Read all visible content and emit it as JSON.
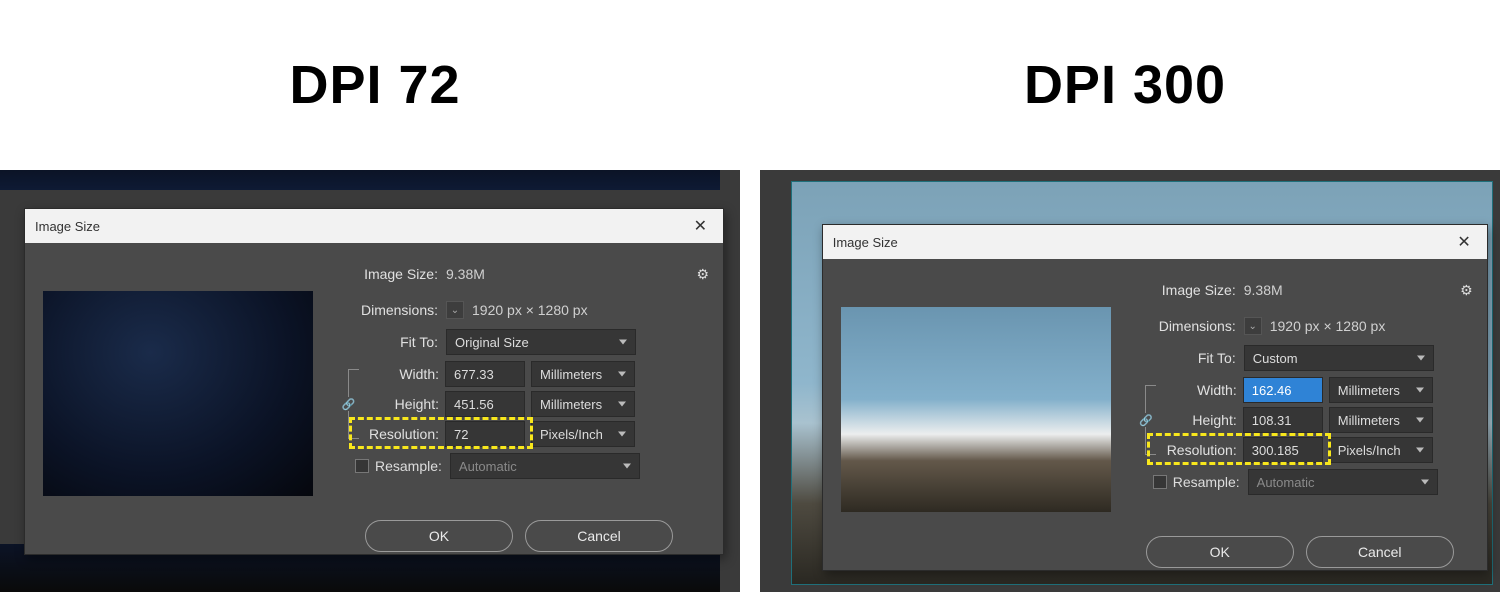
{
  "headings": {
    "left": "DPI 72",
    "right": "DPI 300"
  },
  "dialog": {
    "title": "Image Size",
    "labels": {
      "image_size": "Image Size:",
      "dimensions": "Dimensions:",
      "fit_to": "Fit To:",
      "width": "Width:",
      "height": "Height:",
      "resolution": "Resolution:",
      "resample": "Resample:"
    },
    "buttons": {
      "ok": "OK",
      "cancel": "Cancel"
    },
    "close": "✕",
    "gear": "⚙",
    "dim_toggle": "⌄",
    "link": "🔗"
  },
  "left": {
    "image_size_value": "9.38M",
    "dimensions_value": "1920 px  ×  1280 px",
    "fit_to": "Original Size",
    "width": "677.33",
    "height": "451.56",
    "width_unit": "Millimeters",
    "height_unit": "Millimeters",
    "resolution": "72",
    "resolution_unit": "Pixels/Inch",
    "resample_on": false,
    "resample_mode": "Automatic"
  },
  "right": {
    "image_size_value": "9.38M",
    "dimensions_value": "1920 px  ×  1280 px",
    "fit_to": "Custom",
    "width": "162.46",
    "height": "108.31",
    "width_unit": "Millimeters",
    "height_unit": "Millimeters",
    "resolution": "300.185",
    "resolution_unit": "Pixels/Inch",
    "resample_on": false,
    "resample_mode": "Automatic"
  }
}
